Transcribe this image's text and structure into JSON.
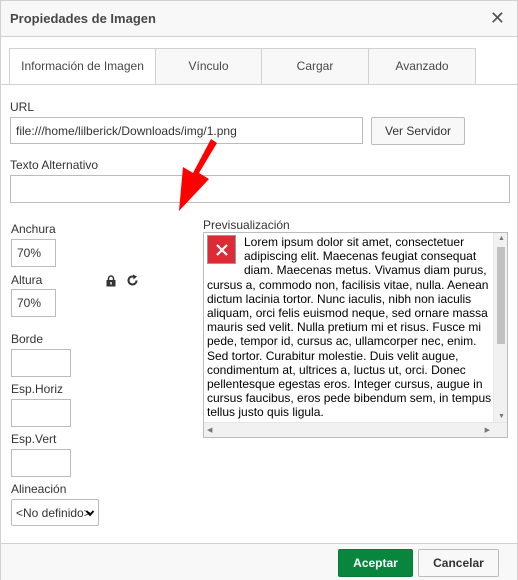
{
  "dialog": {
    "title": "Propiedades de Imagen",
    "close_icon": "close-icon"
  },
  "tabs": [
    {
      "label": "Información de Imagen",
      "active": true
    },
    {
      "label": "Vínculo",
      "active": false
    },
    {
      "label": "Cargar",
      "active": false
    },
    {
      "label": "Avanzado",
      "active": false
    }
  ],
  "url": {
    "label": "URL",
    "value": "file:///home/lilberick/Downloads/img/1.png",
    "browse_label": "Ver Servidor"
  },
  "alt": {
    "label": "Texto Alternativo",
    "value": ""
  },
  "width": {
    "label": "Anchura",
    "value": "70%"
  },
  "height": {
    "label": "Altura",
    "value": "70%"
  },
  "lock_icon": "lock-icon",
  "reset_icon": "reset-size-icon",
  "border": {
    "label": "Borde",
    "value": ""
  },
  "hspace": {
    "label": "Esp.Horiz",
    "value": ""
  },
  "vspace": {
    "label": "Esp.Vert",
    "value": ""
  },
  "align": {
    "label": "Alineación",
    "value": "<No definido>"
  },
  "preview": {
    "label": "Previsualización",
    "text": "Lorem ipsum dolor sit amet, consectetuer adipiscing elit. Maecenas feugiat consequat diam. Maecenas metus. Vivamus diam purus, cursus a, commodo non, facilisis vitae, nulla. Aenean dictum lacinia tortor. Nunc iaculis, nibh non iaculis aliquam, orci felis euismod neque, sed ornare massa mauris sed velit. Nulla pretium mi et risus. Fusce mi pede, tempor id, cursus ac, ullamcorper nec, enim. Sed tortor. Curabitur molestie. Duis velit augue, condimentum at, ultrices a, luctus ut, orci. Donec pellentesque egestas eros. Integer cursus, augue in cursus faucibus, eros pede bibendum sem, in tempus tellus justo quis ligula.",
    "broken_image_icon": "broken-image-icon"
  },
  "footer": {
    "ok_label": "Aceptar",
    "cancel_label": "Cancelar"
  },
  "colors": {
    "accent_green": "#09863e",
    "broken_image_red": "#dd2b35",
    "annotation_red": "#ff0000"
  }
}
